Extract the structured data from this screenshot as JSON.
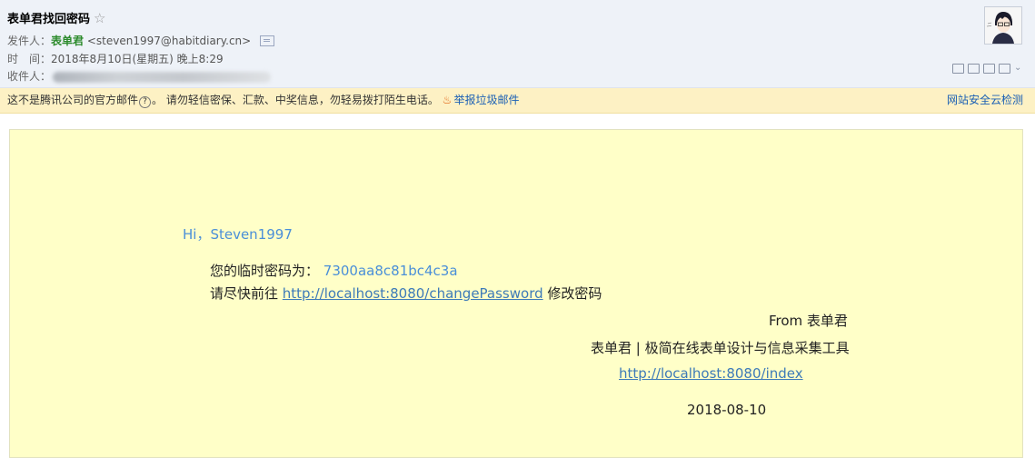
{
  "email": {
    "subject": "表单君找回密码",
    "star": "☆",
    "from_label": "发件人：",
    "from_name": "表单君",
    "from_email": "<steven1997@habitdiary.cn>",
    "time_label": "时　间：",
    "time_value": "2018年8月10日(星期五) 晚上8:29",
    "to_label": "收件人："
  },
  "warning": {
    "text1": "这不是腾讯公司的官方邮件",
    "qmark": "?",
    "text2": "。 请勿轻信密保、汇款、中奖信息，勿轻易拨打陌生电话。",
    "report": "举报垃圾邮件",
    "right": "网站安全云检测"
  },
  "body": {
    "greeting": "Hi，Steven1997",
    "temp_label": "您的临时密码为：",
    "temp_code": "7300aa8c81bc4c3a",
    "goto_prefix": "请尽快前往 ",
    "change_link": "http://localhost:8080/changePassword",
    "goto_suffix": " 修改密码",
    "from_sig": "From 表单君",
    "tagline": "表单君 | 极简在线表单设计与信息采集工具",
    "index_link": "http://localhost:8080/index",
    "date": "2018-08-10"
  },
  "icons": [
    "star-icon",
    "contact-card-icon",
    "question-mark-icon",
    "flame-icon",
    "avatar",
    "toolbar-icons"
  ],
  "colors": {
    "header_bg": "#eef2f8",
    "warn_bg": "#fdf1c4",
    "card_bg": "#ffffc8",
    "link": "#3d7ab8",
    "sender": "#2b8a2b"
  }
}
